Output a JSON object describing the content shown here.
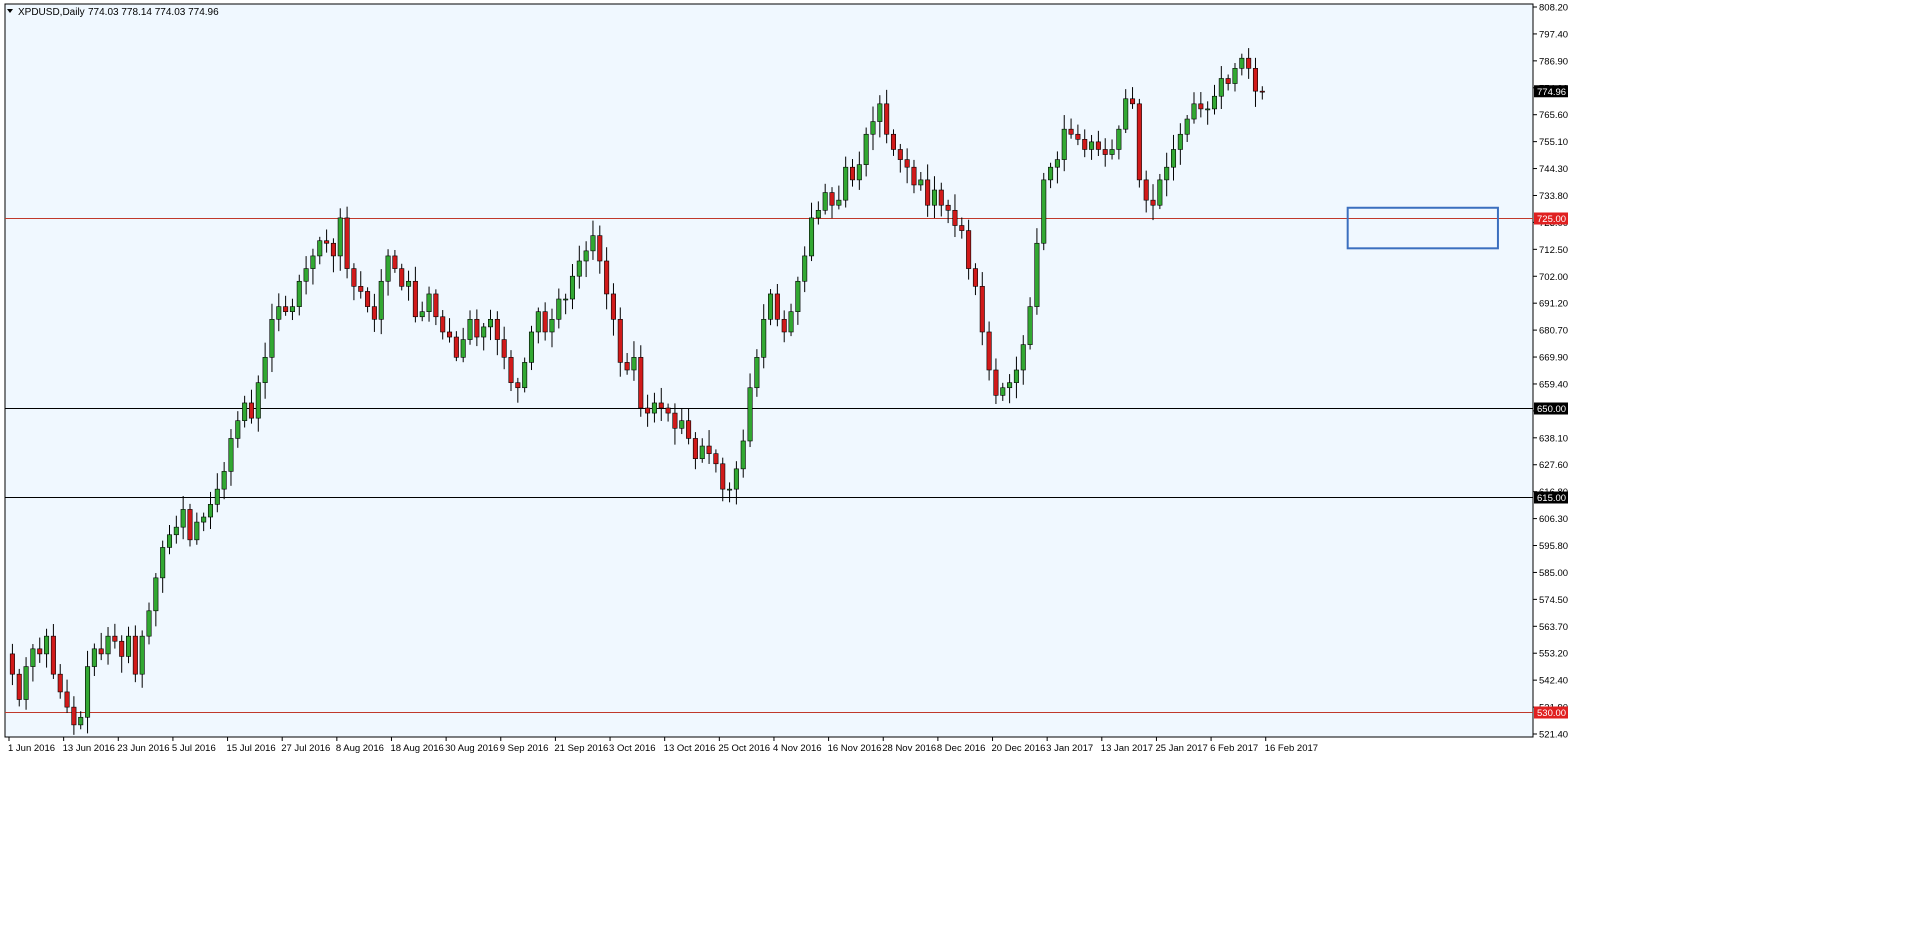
{
  "header": {
    "symbol": "XPDUSD,Daily",
    "ohlc": "774.03 778.14 774.03 774.96"
  },
  "colors": {
    "background": "#f0f8ff",
    "bull": "#32a832",
    "bear": "#d11a1a",
    "wick": "#000000",
    "line_red": "#c0392b",
    "line_black": "#000000",
    "box": "#3b6fbf"
  },
  "chart_data": {
    "type": "candlestick",
    "instrument": "XPDUSD",
    "timeframe": "Daily",
    "ylim": [
      521.4,
      808.2
    ],
    "yticks": [
      "808.20",
      "797.40",
      "786.90",
      "774.96",
      "765.60",
      "755.10",
      "744.30",
      "733.80",
      "723.00",
      "712.50",
      "702.00",
      "691.20",
      "680.70",
      "669.90",
      "659.40",
      "648.60",
      "638.10",
      "627.60",
      "616.80",
      "606.30",
      "595.80",
      "585.00",
      "574.50",
      "563.70",
      "553.20",
      "542.40",
      "531.90",
      "521.40"
    ],
    "xticks": [
      "1 Jun 2016",
      "13 Jun 2016",
      "23 Jun 2016",
      "5 Jul 2016",
      "15 Jul 2016",
      "27 Jul 2016",
      "8 Aug 2016",
      "18 Aug 2016",
      "30 Aug 2016",
      "9 Sep 2016",
      "21 Sep 2016",
      "3 Oct 2016",
      "13 Oct 2016",
      "25 Oct 2016",
      "4 Nov 2016",
      "16 Nov 2016",
      "28 Nov 2016",
      "8 Dec 2016",
      "20 Dec 2016",
      "3 Jan 2017",
      "13 Jan 2017",
      "25 Jan 2017",
      "6 Feb 2017",
      "16 Feb 2017"
    ],
    "x_per_tick": 8,
    "current_price": "774.96",
    "levels": [
      {
        "value": 725.0,
        "label": "725.00",
        "color": "red"
      },
      {
        "value": 650.0,
        "label": "650.00",
        "color": "black"
      },
      {
        "value": 615.0,
        "label": "615.00",
        "color": "black"
      },
      {
        "value": 530.0,
        "label": "530.00",
        "color": "red"
      }
    ],
    "highlight_box": {
      "from_bar": 196,
      "to_bar": 218,
      "price_top": 729,
      "price_bottom": 713
    },
    "closes": [
      545,
      535,
      548,
      555,
      553,
      560,
      545,
      538,
      532,
      525,
      528,
      548,
      555,
      553,
      560,
      558,
      552,
      560,
      545,
      560,
      570,
      583,
      595,
      600,
      603,
      610,
      598,
      605,
      607,
      612,
      618,
      625,
      638,
      645,
      652,
      646,
      660,
      670,
      685,
      690,
      688,
      690,
      700,
      705,
      710,
      716,
      715,
      710,
      725,
      705,
      698,
      696,
      690,
      685,
      700,
      710,
      705,
      698,
      700,
      686,
      688,
      695,
      686,
      680,
      678,
      670,
      677,
      685,
      678,
      682,
      685,
      677,
      670,
      660,
      658,
      668,
      680,
      688,
      680,
      685,
      693,
      693,
      702,
      708,
      712,
      718,
      708,
      695,
      685,
      668,
      665,
      670,
      650,
      648,
      652,
      650,
      648,
      642,
      645,
      638,
      630,
      635,
      632,
      628,
      618,
      618,
      626,
      637,
      658,
      670,
      685,
      695,
      685,
      680,
      688,
      700,
      710,
      725,
      728,
      735,
      730,
      732,
      745,
      740,
      746,
      758,
      763,
      770,
      758,
      752,
      748,
      745,
      738,
      740,
      730,
      736,
      730,
      728,
      722,
      720,
      705,
      698,
      680,
      665,
      655,
      658,
      660,
      665,
      675,
      690,
      715,
      740,
      745,
      748,
      760,
      758,
      756,
      752,
      755,
      752,
      750,
      752,
      760,
      772,
      770,
      740,
      732,
      730,
      740,
      745,
      752,
      758,
      764,
      770,
      768,
      768,
      773,
      780,
      778,
      784,
      788,
      784,
      775,
      774.96
    ]
  }
}
